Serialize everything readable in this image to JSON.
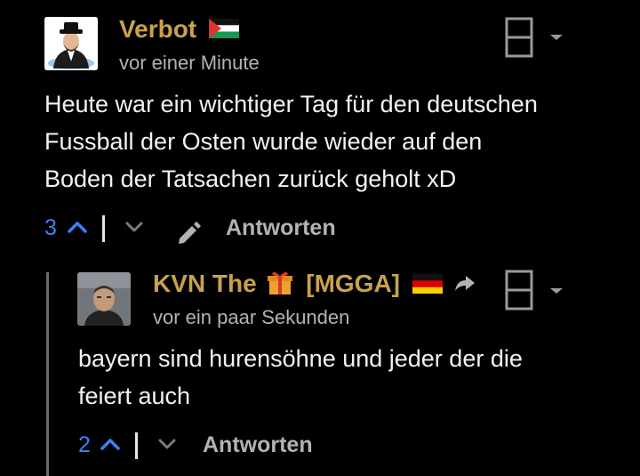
{
  "comments": [
    {
      "author": "Verbot",
      "time": "vor einer Minute",
      "lines": [
        "Heute war ein wichtiger Tag für den deutschen",
        "Fussball der Osten wurde wieder auf den",
        "Boden der Tatsachen zurück geholt xD"
      ],
      "votes": "3",
      "reply_label": "Antworten",
      "flag": "palestine-flag"
    },
    {
      "author": "KVN The",
      "author_tag": "[MGGA]",
      "time": "vor ein paar Sekunden",
      "lines": [
        "bayern sind hurensöhne und jeder der die",
        "feiert auch"
      ],
      "votes": "2",
      "reply_label": "Antworten",
      "flag": "germany-flag"
    }
  ],
  "colors": {
    "background": "#000000",
    "author": "#c9a24a",
    "vote_count": "#3b82f6",
    "muted": "#b3b3b3"
  }
}
